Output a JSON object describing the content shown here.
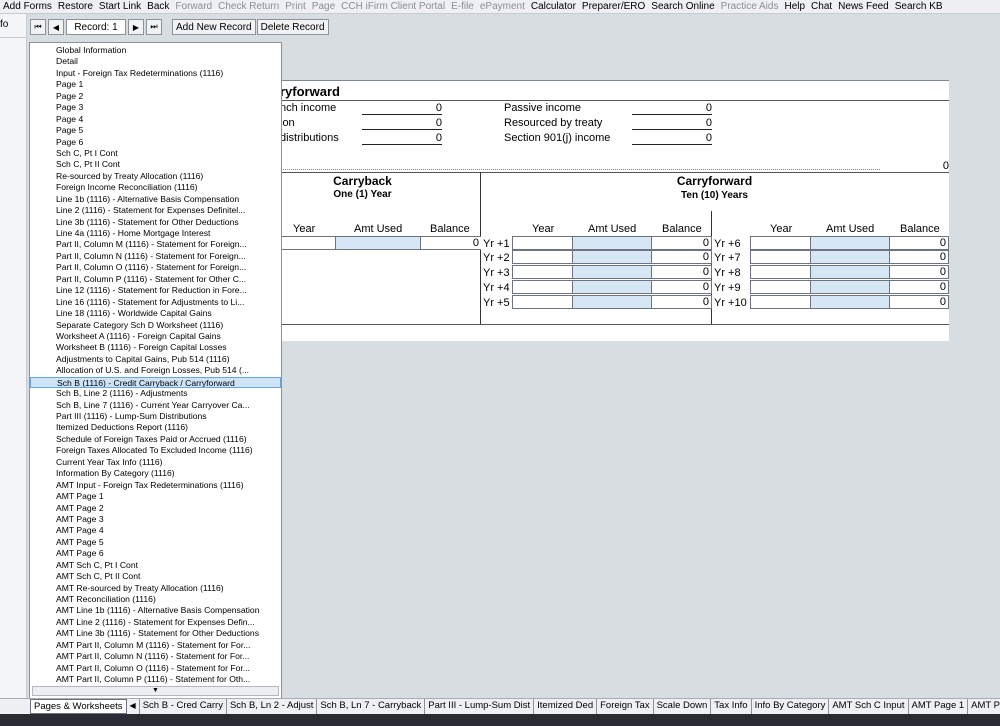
{
  "menu": [
    "Add Forms",
    "Restore",
    "Start Link",
    "Back",
    "Forward",
    "Check Return",
    "Print",
    "Page",
    "CCH iFirm Client Portal",
    "E-file",
    "ePayment",
    "Calculator",
    "Preparer/ERO",
    "Search Online",
    "Practice Aids",
    "Help",
    "Chat",
    "News Feed",
    "Search KB"
  ],
  "menu_disabled": [
    4,
    5,
    6,
    7,
    8,
    9,
    10,
    14
  ],
  "left_strip_label": "fo",
  "toolbar": {
    "first_icon": "⏮",
    "prev_icon": "◀",
    "record_label": "Record: 1",
    "next_icon": "▶",
    "last_icon": "⏭",
    "add_record": "Add New Record",
    "delete_record": "Delete Record"
  },
  "form": {
    "title": "ryforward",
    "left_fields": [
      {
        "label": "nch income",
        "value": "0"
      },
      {
        "label": "ion",
        "value": "0"
      },
      {
        "label": "distributions",
        "value": "0"
      }
    ],
    "right_fields": [
      {
        "label": "Passive income",
        "value": "0"
      },
      {
        "label": "Resourced by treaty",
        "value": "0"
      },
      {
        "label": "Section 901(j) income",
        "value": "0"
      }
    ],
    "total_value": "0",
    "carryback": {
      "title": "Carryback",
      "subtitle": "One (1) Year",
      "headers": [
        "Year",
        "Amt Used",
        "Balance"
      ],
      "balance": "0"
    },
    "carryforward": {
      "title": "Carryforward",
      "subtitle": "Ten (10) Years",
      "headers": [
        "Year",
        "Amt Used",
        "Balance"
      ],
      "left_rows": [
        {
          "label": "Yr +1",
          "balance": "0"
        },
        {
          "label": "Yr +2",
          "balance": "0"
        },
        {
          "label": "Yr +3",
          "balance": "0"
        },
        {
          "label": "Yr +4",
          "balance": "0"
        },
        {
          "label": "Yr +5",
          "balance": "0"
        }
      ],
      "right_rows": [
        {
          "label": "Yr +6",
          "balance": "0"
        },
        {
          "label": "Yr +7",
          "balance": "0"
        },
        {
          "label": "Yr +8",
          "balance": "0"
        },
        {
          "label": "Yr +9",
          "balance": "0"
        },
        {
          "label": "Yr +10",
          "balance": "0"
        }
      ]
    }
  },
  "pagelist": {
    "selected_index": 29,
    "scroll_icon": "▼",
    "items": [
      "Global Information",
      "Detail",
      "Input - Foreign Tax Redeterminations (1116)",
      "Page 1",
      "Page 2",
      "Page 3",
      "Page 4",
      "Page 5",
      "Page 6",
      "Sch C, Pt I Cont",
      "Sch C, Pt II Cont",
      "Re-sourced by Treaty Allocation (1116)",
      "Foreign Income Reconciliation (1116)",
      "Line 1b (1116) - Alternative Basis Compensation",
      "Line 2 (1116) - Statement for Expenses Definitel...",
      "Line 3b (1116) - Statement for Other Deductions",
      "Line 4a (1116) - Home Mortgage Interest",
      "Part II, Column M (1116) - Statement for Foreign...",
      "Part II, Column N (1116) - Statement for Foreign...",
      "Part II, Column O (1116) - Statement for Foreign...",
      "Part II, Column P (1116) - Statement for Other C...",
      "Line 12 (1116) - Statement for Reduction in Fore...",
      "Line 16 (1116) - Statement for Adjustments to Li...",
      "Line 18 (1116) - Worldwide Capital Gains",
      "Separate Category Sch D Worksheet (1116)",
      "Worksheet A (1116) - Foreign Capital Gains",
      "Worksheet B (1116) - Foreign Capital Losses",
      "Adjustments to Capital Gains, Pub 514 (1116)",
      "Allocation of U.S. and Foreign Losses, Pub 514 (...",
      "Sch B (1116) - Credit Carryback / Carryforward",
      "Sch B, Line 2 (1116) - Adjustments",
      "Sch B, Line 7 (1116) - Current Year Carryover Ca...",
      "Part III (1116) - Lump-Sum Distributions",
      "Itemized Deductions Report (1116)",
      "Schedule of Foreign Taxes Paid or Accrued (1116)",
      "Foreign Taxes Allocated To Excluded Income (1116)",
      "Current Year Tax Info (1116)",
      "Information By Category (1116)",
      "AMT Input - Foreign Tax Redeterminations (1116)",
      "AMT Page 1",
      "AMT Page 2",
      "AMT Page 3",
      "AMT Page 4",
      "AMT Page 5",
      "AMT Page 6",
      "AMT Sch C, Pt I Cont",
      "AMT Sch C, Pt II Cont",
      "AMT Re-sourced by Treaty Allocation (1116)",
      "AMT Reconciliation (1116)",
      "AMT Line 1b (1116) - Alternative Basis Compensation",
      "AMT Line 2 (1116) - Statement for Expenses Defin...",
      "AMT Line 3b (1116) - Statement for Other Deductions",
      "AMT Part II, Column M (1116) - Statement for For...",
      "AMT Part II, Column N (1116) - Statement for For...",
      "AMT Part II, Column O (1116) - Statement for For...",
      "AMT Part II, Column P (1116) - Statement for Oth..."
    ]
  },
  "tabs": {
    "first": "Pages & Worksheets",
    "arrow": "◀",
    "items": [
      "Sch B - Cred Carry",
      "Sch B, Ln 2 - Adjust",
      "Sch B, Ln 7 - Carryback",
      "Part III - Lump-Sum Dist",
      "Itemized Ded",
      "Foreign Tax",
      "Scale Down",
      "Tax Info",
      "Info By Category",
      "AMT Sch C Input",
      "AMT Page 1",
      "AMT Page 2",
      "A"
    ]
  }
}
